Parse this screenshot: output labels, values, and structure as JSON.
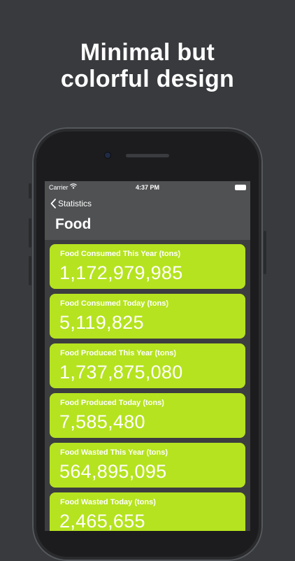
{
  "headline": {
    "line1": "Minimal but",
    "line2": "colorful design"
  },
  "status_bar": {
    "carrier": "Carrier",
    "time": "4:37 PM"
  },
  "nav": {
    "back_label": "Statistics",
    "title": "Food"
  },
  "accent_color": "#b5e31f",
  "cards": [
    {
      "label": "Food Consumed This Year (tons)",
      "value": "1,172,979,985"
    },
    {
      "label": "Food Consumed Today (tons)",
      "value": "5,119,825"
    },
    {
      "label": "Food Produced This Year (tons)",
      "value": "1,737,875,080"
    },
    {
      "label": "Food Produced Today (tons)",
      "value": "7,585,480"
    },
    {
      "label": "Food Wasted This Year (tons)",
      "value": "564,895,095"
    },
    {
      "label": "Food Wasted Today (tons)",
      "value": "2,465,655"
    }
  ]
}
